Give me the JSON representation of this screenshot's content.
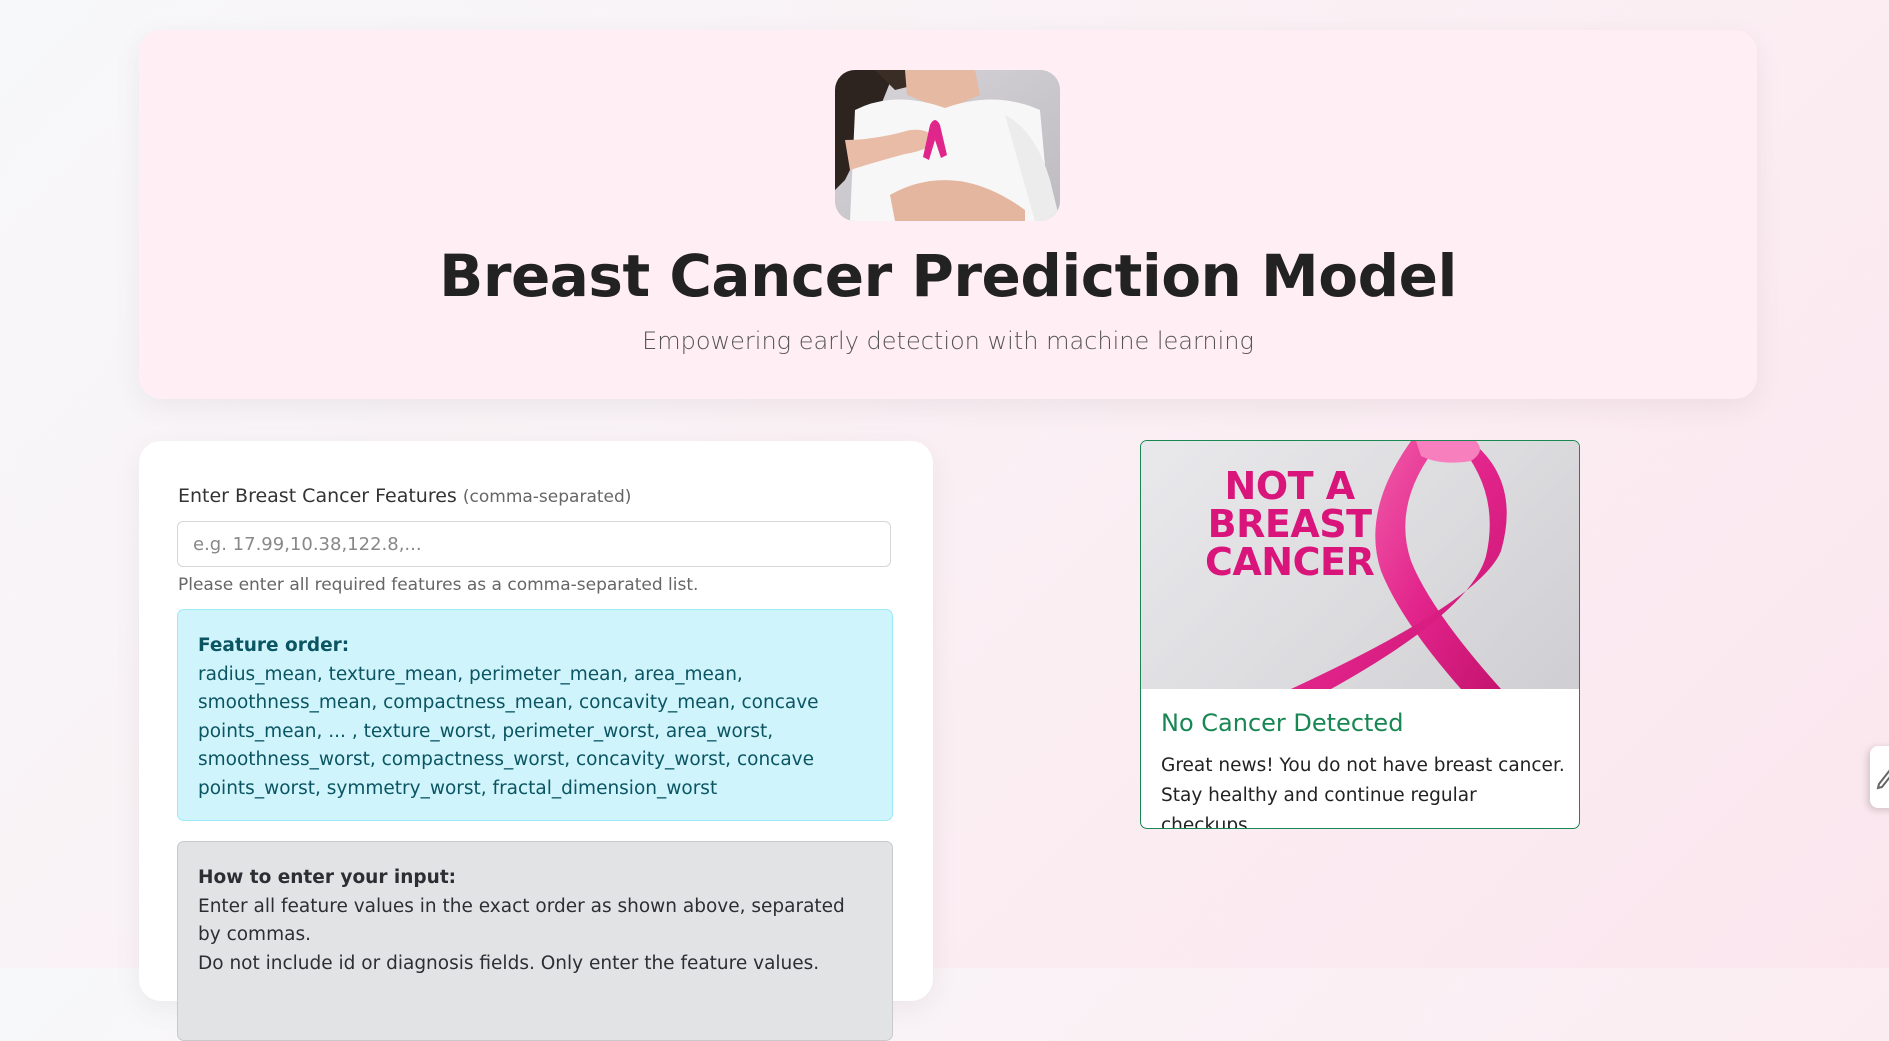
{
  "hero": {
    "title": "Breast Cancer Prediction Model",
    "subtitle": "Empowering early detection with machine learning"
  },
  "form": {
    "label": "Enter Breast Cancer Features",
    "label_hint": "(comma-separated)",
    "input_value": "",
    "input_placeholder": "e.g. 17.99,10.38,122.8,...",
    "help_text": "Please enter all required features as a comma-separated list.",
    "feature_order": {
      "heading": "Feature order:",
      "text": "radius_mean, texture_mean, perimeter_mean, area_mean, smoothness_mean, compactness_mean, concavity_mean, concave points_mean, ... , texture_worst, perimeter_worst, area_worst, smoothness_worst, compactness_worst, concavity_worst, concave points_worst, symmetry_worst, fractal_dimension_worst"
    },
    "how_to": {
      "heading": "How to enter your input:",
      "line1": "Enter all feature values in the exact order as shown above, separated by commas.",
      "line2": "Do not include id or diagnosis fields. Only enter the feature values."
    }
  },
  "result": {
    "image_text_line1": "NOT A",
    "image_text_line2": "BREAST",
    "image_text_line3": "CANCER",
    "title": "No Cancer Detected",
    "message": "Great news! You do not have breast cancer. Stay healthy and continue regular checkups."
  },
  "icons": {
    "side_tab": "edit-pen-icon",
    "ribbon": "pink-ribbon-icon"
  },
  "colors": {
    "hero_bg": "#ffeef3",
    "success": "#198754",
    "ribbon_pink": "#d9147a",
    "info_bg": "#cff4fb",
    "info_text": "#0b5563",
    "howto_bg": "#e2e3e5"
  }
}
